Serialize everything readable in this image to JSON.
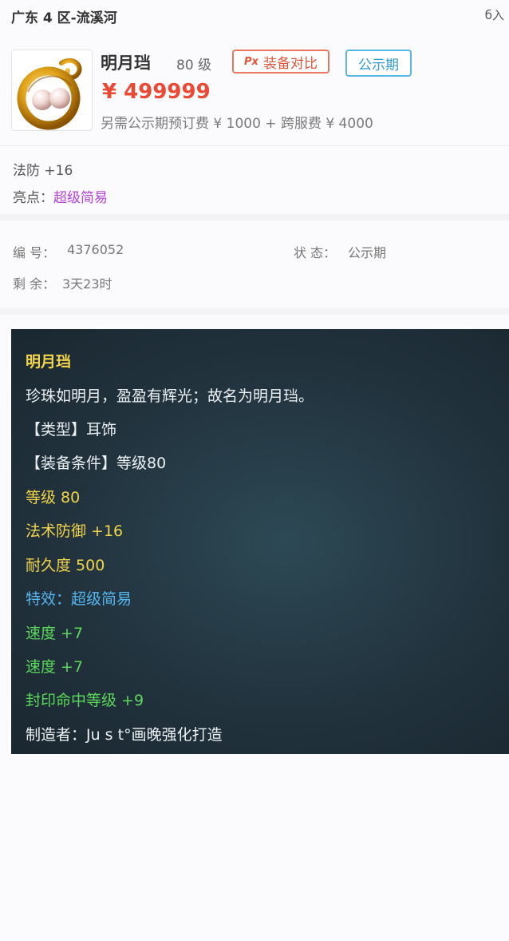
{
  "header": {
    "server": "广东 4 区-流溪河",
    "corner_icon": "share-icon",
    "corner_text": "б入"
  },
  "item": {
    "thumbnail_icon": "pearl-earring-icon",
    "name": "明月珰",
    "level": "80 级",
    "compare_label": "装备对比",
    "compare_icon_text": "Px",
    "public_label": "公示期",
    "price": "¥ 499999",
    "fee_note": "另需公示期预订费 ¥ 1000 + 跨服费 ¥ 4000"
  },
  "attributes": {
    "stat": "法防 +16",
    "highlight_label": "亮点：",
    "highlight_value": "超级简易"
  },
  "info": {
    "id_label": "编 号：",
    "id_value": "4376052",
    "status_label": "状 态：",
    "status_value": "公示期",
    "remain_label": "剩 余：",
    "remain_value": "3天23时"
  },
  "description": {
    "lines": [
      {
        "text": "明月珰",
        "color": "#f2d44a"
      },
      {
        "text": "珍珠如明月，盈盈有辉光；故名为明月珰。",
        "color": "#ecf1f3"
      },
      {
        "text": "【类型】耳饰",
        "color": "#ecf1f3"
      },
      {
        "text": "【装备条件】等级80",
        "color": "#ecf1f3"
      },
      {
        "text": "等级 80",
        "color": "#f2d44a"
      },
      {
        "text": "法术防御 +16",
        "color": "#f2d44a"
      },
      {
        "text": "耐久度 500",
        "color": "#f2d44a"
      },
      {
        "text": "特效：超级简易",
        "color": "#57b6f0"
      },
      {
        "text": "速度 +7",
        "color": "#5cd85a"
      },
      {
        "text": "速度 +7",
        "color": "#5cd85a"
      },
      {
        "text": "封印命中等级 +9",
        "color": "#5cd85a"
      },
      {
        "text": "制造者：Ju s t°画晚强化打造",
        "color": "#ecf1f3"
      }
    ]
  }
}
